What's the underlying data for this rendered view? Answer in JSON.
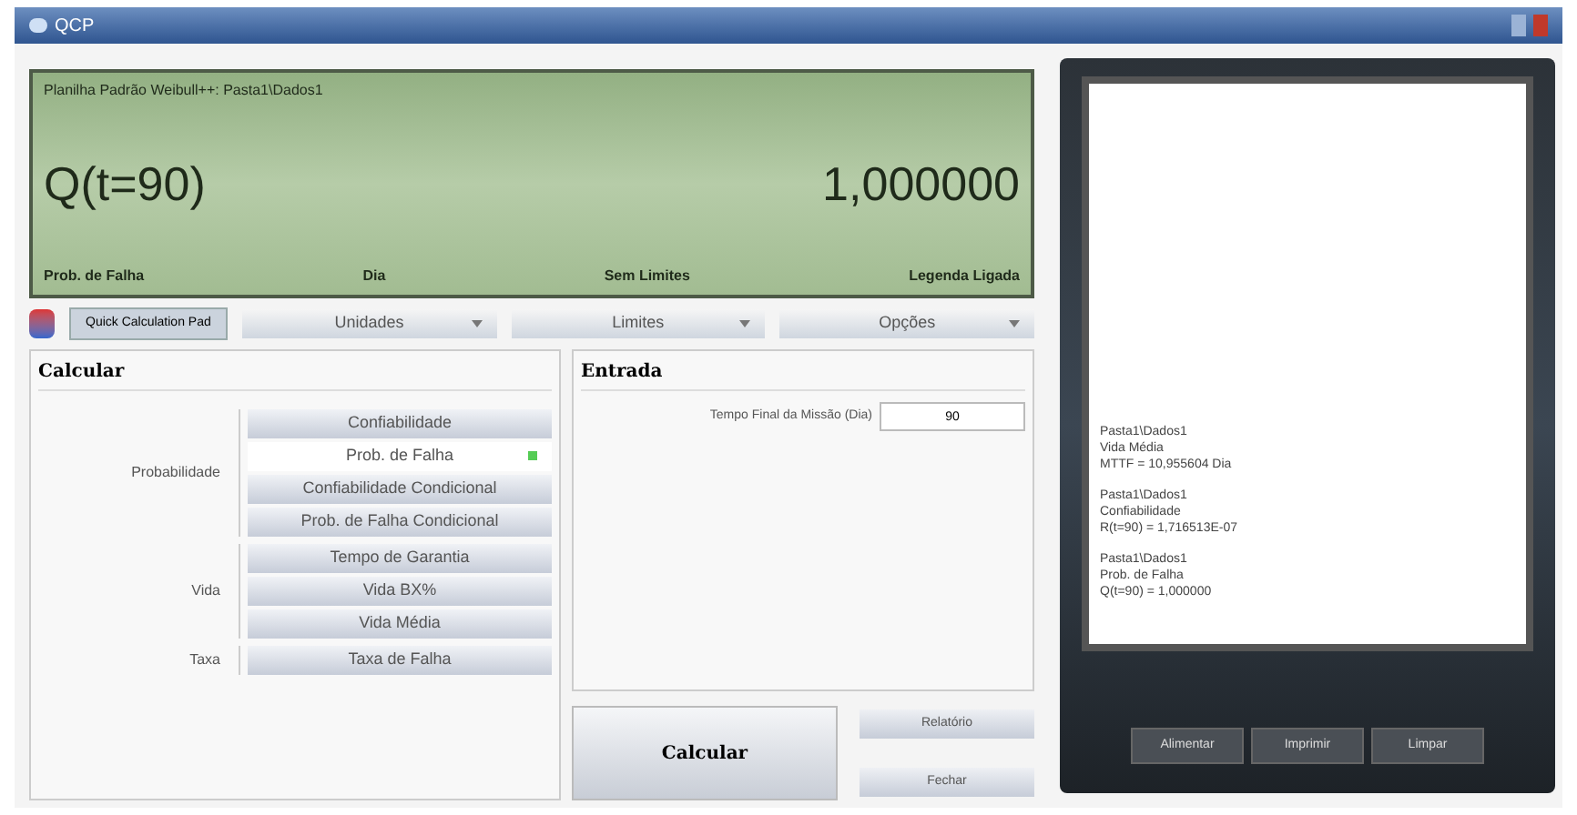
{
  "window": {
    "title": "QCP"
  },
  "display": {
    "header": "Planilha Padrão Weibull++: Pasta1\\Dados1",
    "expression": "Q(t=90)",
    "value": "1,000000",
    "footer": [
      "Prob. de Falha",
      "Dia",
      "Sem Limites",
      "Legenda Ligada"
    ]
  },
  "toolbar": {
    "logo_label": "Quick Calculation Pad",
    "menus": [
      "Unidades",
      "Limites",
      "Opções"
    ]
  },
  "calcular": {
    "title": "Calcular",
    "groups": [
      {
        "label": "Probabilidade",
        "options": [
          {
            "label": "Confiabilidade",
            "selected": false
          },
          {
            "label": "Prob. de Falha",
            "selected": true
          },
          {
            "label": "Confiabilidade Condicional",
            "selected": false
          },
          {
            "label": "Prob. de Falha Condicional",
            "selected": false
          }
        ]
      },
      {
        "label": "Vida",
        "options": [
          {
            "label": "Tempo de Garantia",
            "selected": false
          },
          {
            "label": "Vida BX%",
            "selected": false
          },
          {
            "label": "Vida Média",
            "selected": false
          }
        ]
      },
      {
        "label": "Taxa",
        "options": [
          {
            "label": "Taxa de Falha",
            "selected": false
          }
        ]
      }
    ]
  },
  "entrada": {
    "title": "Entrada",
    "fields": [
      {
        "label": "Tempo Final da Missão (Dia)",
        "value": "90"
      }
    ]
  },
  "actions": {
    "primary": "Calcular",
    "secondary": [
      "Relatório",
      "Fechar"
    ]
  },
  "log": {
    "entries": [
      [
        "Pasta1\\Dados1",
        "Vida Média",
        "MTTF = 10,955604 Dia"
      ],
      [
        "Pasta1\\Dados1",
        "Confiabilidade",
        "R(t=90) = 1,716513E-07"
      ],
      [
        "Pasta1\\Dados1",
        "Prob. de Falha",
        "Q(t=90) = 1,000000"
      ]
    ],
    "buttons": [
      "Alimentar",
      "Imprimir",
      "Limpar"
    ]
  }
}
